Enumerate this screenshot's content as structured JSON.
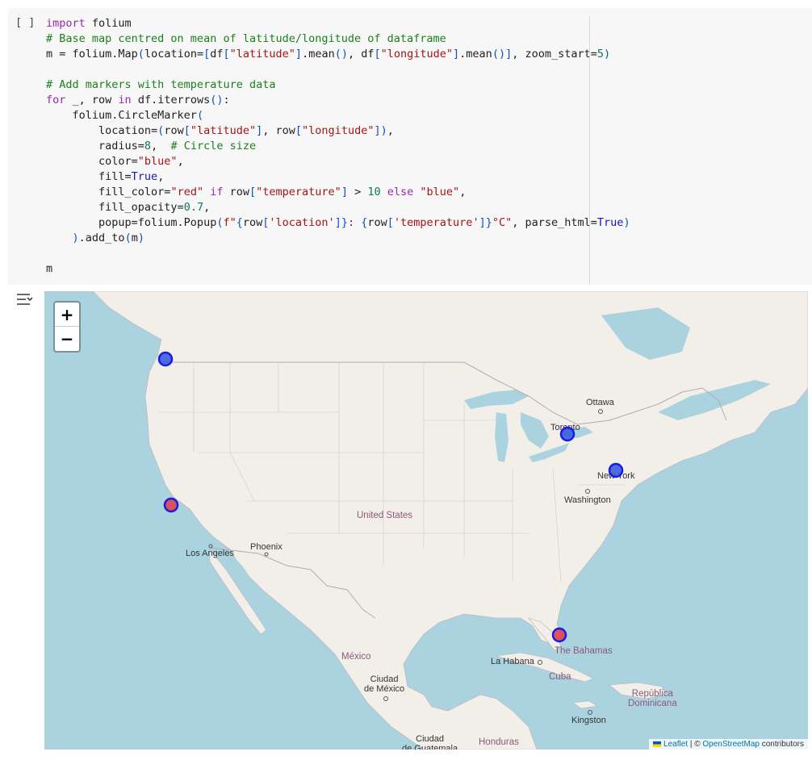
{
  "cell": {
    "run_indicator": "[ ]",
    "code_lines": [
      [
        {
          "t": "import",
          "c": "k"
        },
        {
          "t": " folium",
          "c": ""
        }
      ],
      [
        {
          "t": "# Base map centred on mean of latitude/longitude of dataframe",
          "c": "c"
        }
      ],
      [
        {
          "t": "m = folium.Map",
          "c": ""
        },
        {
          "t": "(",
          "c": "p"
        },
        {
          "t": "location=",
          "c": ""
        },
        {
          "t": "[",
          "c": "p"
        },
        {
          "t": "df",
          "c": ""
        },
        {
          "t": "[",
          "c": "p"
        },
        {
          "t": "\"latitude\"",
          "c": "s"
        },
        {
          "t": "]",
          "c": "p"
        },
        {
          "t": ".mean",
          "c": ""
        },
        {
          "t": "()",
          "c": "p"
        },
        {
          "t": ", df",
          "c": ""
        },
        {
          "t": "[",
          "c": "p"
        },
        {
          "t": "\"longitude\"",
          "c": "s"
        },
        {
          "t": "]",
          "c": "p"
        },
        {
          "t": ".mean",
          "c": ""
        },
        {
          "t": "()",
          "c": "p"
        },
        {
          "t": "]",
          "c": "p"
        },
        {
          "t": ", zoom_start=",
          "c": ""
        },
        {
          "t": "5",
          "c": "n"
        },
        {
          "t": ")",
          "c": "p"
        }
      ],
      [],
      [
        {
          "t": "# Add markers with temperature data",
          "c": "c"
        }
      ],
      [
        {
          "t": "for",
          "c": "k"
        },
        {
          "t": " _, row ",
          "c": ""
        },
        {
          "t": "in",
          "c": "k"
        },
        {
          "t": " df.iterrows",
          "c": ""
        },
        {
          "t": "()",
          "c": "p"
        },
        {
          "t": ":",
          "c": ""
        }
      ],
      [
        {
          "t": "    folium.CircleMarker",
          "c": ""
        },
        {
          "t": "(",
          "c": "p"
        }
      ],
      [
        {
          "t": "        location=",
          "c": ""
        },
        {
          "t": "(",
          "c": "p"
        },
        {
          "t": "row",
          "c": ""
        },
        {
          "t": "[",
          "c": "p"
        },
        {
          "t": "\"latitude\"",
          "c": "s"
        },
        {
          "t": "]",
          "c": "p"
        },
        {
          "t": ", row",
          "c": ""
        },
        {
          "t": "[",
          "c": "p"
        },
        {
          "t": "\"longitude\"",
          "c": "s"
        },
        {
          "t": "]",
          "c": "p"
        },
        {
          "t": ")",
          "c": "p"
        },
        {
          "t": ",",
          "c": ""
        }
      ],
      [
        {
          "t": "        radius=",
          "c": ""
        },
        {
          "t": "8",
          "c": "n"
        },
        {
          "t": ",  ",
          "c": ""
        },
        {
          "t": "# Circle size",
          "c": "c"
        }
      ],
      [
        {
          "t": "        color=",
          "c": ""
        },
        {
          "t": "\"blue\"",
          "c": "s"
        },
        {
          "t": ",",
          "c": ""
        }
      ],
      [
        {
          "t": "        fill=",
          "c": ""
        },
        {
          "t": "True",
          "c": "b"
        },
        {
          "t": ",",
          "c": ""
        }
      ],
      [
        {
          "t": "        fill_color=",
          "c": ""
        },
        {
          "t": "\"red\"",
          "c": "s"
        },
        {
          "t": " ",
          "c": ""
        },
        {
          "t": "if",
          "c": "k"
        },
        {
          "t": " row",
          "c": ""
        },
        {
          "t": "[",
          "c": "p"
        },
        {
          "t": "\"temperature\"",
          "c": "s"
        },
        {
          "t": "]",
          "c": "p"
        },
        {
          "t": " > ",
          "c": ""
        },
        {
          "t": "10",
          "c": "n"
        },
        {
          "t": " ",
          "c": ""
        },
        {
          "t": "else",
          "c": "k"
        },
        {
          "t": " ",
          "c": ""
        },
        {
          "t": "\"blue\"",
          "c": "s"
        },
        {
          "t": ",",
          "c": ""
        }
      ],
      [
        {
          "t": "        fill_opacity=",
          "c": ""
        },
        {
          "t": "0.7",
          "c": "n"
        },
        {
          "t": ",",
          "c": ""
        }
      ],
      [
        {
          "t": "        popup=folium.Popup",
          "c": ""
        },
        {
          "t": "(",
          "c": "p"
        },
        {
          "t": "f\"",
          "c": "s"
        },
        {
          "t": "{",
          "c": "p"
        },
        {
          "t": "row",
          "c": ""
        },
        {
          "t": "[",
          "c": "p"
        },
        {
          "t": "'location'",
          "c": "s"
        },
        {
          "t": "]",
          "c": "p"
        },
        {
          "t": "}",
          "c": "p"
        },
        {
          "t": ": ",
          "c": "s"
        },
        {
          "t": "{",
          "c": "p"
        },
        {
          "t": "row",
          "c": ""
        },
        {
          "t": "[",
          "c": "p"
        },
        {
          "t": "'temperature'",
          "c": "s"
        },
        {
          "t": "]",
          "c": "p"
        },
        {
          "t": "}",
          "c": "p"
        },
        {
          "t": "°C\"",
          "c": "s"
        },
        {
          "t": ", parse_html=",
          "c": ""
        },
        {
          "t": "True",
          "c": "b"
        },
        {
          "t": ")",
          "c": "p"
        }
      ],
      [
        {
          "t": "    ",
          "c": ""
        },
        {
          "t": ")",
          "c": "p"
        },
        {
          "t": ".add_to",
          "c": ""
        },
        {
          "t": "(",
          "c": "p"
        },
        {
          "t": "m",
          "c": ""
        },
        {
          "t": ")",
          "c": "p"
        }
      ],
      [],
      [
        {
          "t": "m",
          "c": ""
        }
      ]
    ]
  },
  "map": {
    "zoom_in": "+",
    "zoom_out": "−",
    "labels": {
      "ottawa": "Ottawa",
      "toronto": "Toronto",
      "new_york": "New York",
      "washington": "Washington",
      "united_states": "United States",
      "phoenix": "Phoenix",
      "los_angeles": "Los Angeles",
      "mexico": "México",
      "ciudad_de_mexico": "Ciudad\nde México",
      "la_habana": "La Habana",
      "cuba": "Cuba",
      "bahamas": "The Bahamas",
      "republica_dominicana": "República\nDominicana",
      "kingston": "Kingston",
      "honduras": "Honduras",
      "ciudad_guatemala": "Ciudad\nde Guatemala"
    },
    "markers": [
      {
        "name": "Vancouver",
        "fill": "#3355dd",
        "above_10": false
      },
      {
        "name": "Toronto",
        "fill": "#3355dd",
        "above_10": false
      },
      {
        "name": "New York",
        "fill": "#3355dd",
        "above_10": false
      },
      {
        "name": "San Francisco",
        "fill": "#e0414f",
        "above_10": true
      },
      {
        "name": "Miami",
        "fill": "#e0414f",
        "above_10": true
      }
    ],
    "marker_stroke": "#1a1ae6",
    "attribution": {
      "leaflet": "Leaflet",
      "separator": "| ©",
      "osm": "OpenStreetMap",
      "contributors": "contributors"
    }
  },
  "colors": {
    "water": "#aad3df",
    "land": "#f2efe9",
    "border": "#b8a6b8"
  }
}
